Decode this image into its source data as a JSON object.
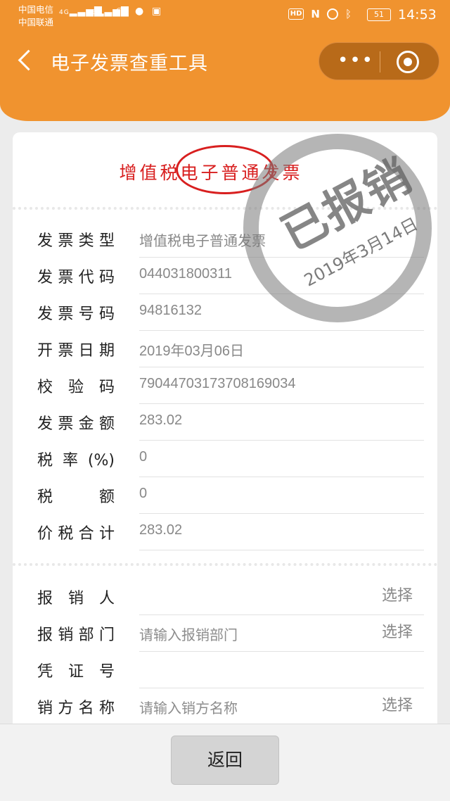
{
  "status_bar": {
    "carrier1": "中国电信",
    "carrier2": "中国联通",
    "sig1_tag": "4G",
    "sig2_tag": "3G",
    "hd": "HD",
    "nfc": "N",
    "battery": "51",
    "time": "14:53"
  },
  "nav": {
    "title": "电子发票查重工具",
    "more": "•••"
  },
  "invoice": {
    "title": "增值税电子普通发票",
    "fields": [
      {
        "label": "发票类型",
        "value": "增值税电子普通发票"
      },
      {
        "label": "发票代码",
        "value": "044031800311"
      },
      {
        "label": "发票号码",
        "value": "94816132"
      },
      {
        "label": "开票日期",
        "value": "2019年03月06日"
      },
      {
        "label": "校验码",
        "value": "79044703173708169034"
      },
      {
        "label": "发票金额",
        "value": "283.02"
      },
      {
        "label": "税率(%)",
        "value": "0"
      },
      {
        "label": "税额",
        "value": "0"
      },
      {
        "label": "价税合计",
        "value": "283.02"
      }
    ]
  },
  "stamp": {
    "text": "已报销",
    "date": "2019年3月14日"
  },
  "reimbursement": {
    "fields": [
      {
        "label": "报销人",
        "placeholder": "",
        "action": "选择"
      },
      {
        "label": "报销部门",
        "placeholder": "请输入报销部门",
        "action": "选择"
      },
      {
        "label": "凭证号",
        "placeholder": ""
      },
      {
        "label": "销方名称",
        "placeholder": "请输入销方名称",
        "action": "选择"
      }
    ]
  },
  "footer": {
    "return_label": "返回"
  }
}
